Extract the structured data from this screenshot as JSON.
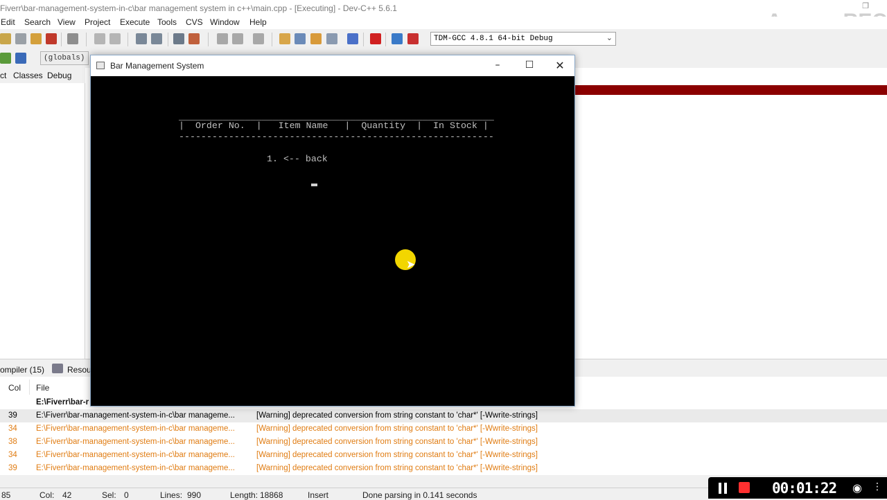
{
  "window": {
    "title": "Fiverr\\bar-management-system-in-c\\bar management system in c++\\main.cpp - [Executing] - Dev-C++ 5.6.1",
    "watermark": "ApowerREC"
  },
  "menu": [
    "Edit",
    "Search",
    "View",
    "Project",
    "Execute",
    "Tools",
    "CVS",
    "Window",
    "Help"
  ],
  "toolbar": {
    "compiler": "TDM-GCC 4.8.1 64-bit Debug",
    "scope": "(globals)"
  },
  "left_tabs": [
    "ct",
    "Classes",
    "Debug"
  ],
  "bottom_tabs": [
    "ompiler (15)",
    "Resou"
  ],
  "table": {
    "headers": [
      "Col",
      "File"
    ],
    "rows": [
      {
        "line": "",
        "file": "E:\\Fiverr\\bar-r",
        "message": ""
      },
      {
        "line": "39",
        "file": "E:\\Fiverr\\bar-management-system-in-c\\bar manageme...",
        "message": "[Warning] deprecated conversion from string constant to 'char*' [-Wwrite-strings]"
      },
      {
        "line": "34",
        "file": "E:\\Fiverr\\bar-management-system-in-c\\bar manageme...",
        "message": "[Warning] deprecated conversion from string constant to 'char*' [-Wwrite-strings]"
      },
      {
        "line": "38",
        "file": "E:\\Fiverr\\bar-management-system-in-c\\bar manageme...",
        "message": "[Warning] deprecated conversion from string constant to 'char*' [-Wwrite-strings]"
      },
      {
        "line": "34",
        "file": "E:\\Fiverr\\bar-management-system-in-c\\bar manageme...",
        "message": "[Warning] deprecated conversion from string constant to 'char*' [-Wwrite-strings]"
      },
      {
        "line": "39",
        "file": "E:\\Fiverr\\bar-management-system-in-c\\bar manageme...",
        "message": "[Warning] deprecated conversion from string constant to 'char*' [-Wwrite-strings]"
      }
    ]
  },
  "status": {
    "line_num": "85",
    "col": "Col:",
    "col_val": "42",
    "sel": "Sel:",
    "sel_val": "0",
    "lines": "Lines:",
    "lines_val": "990",
    "length": "Length:",
    "length_val": "18868",
    "mode": "Insert",
    "message": "Done parsing in 0.141 seconds"
  },
  "console": {
    "title": "Bar Management System",
    "rule_top": "_________________________________________________________",
    "header_line": "|  Order No.  |   Item Name   |  Quantity  |  In Stock |",
    "rule_bottom": "---------------------------------------------------------",
    "menu_item": "1. <-- back"
  },
  "recorder": {
    "timer": "00:01:22"
  },
  "colors": {
    "error_line": "#8b0000",
    "warning_text": "#e07c12",
    "recorder_stop": "#ff3030",
    "cursor_highlight": "#ffe200"
  }
}
